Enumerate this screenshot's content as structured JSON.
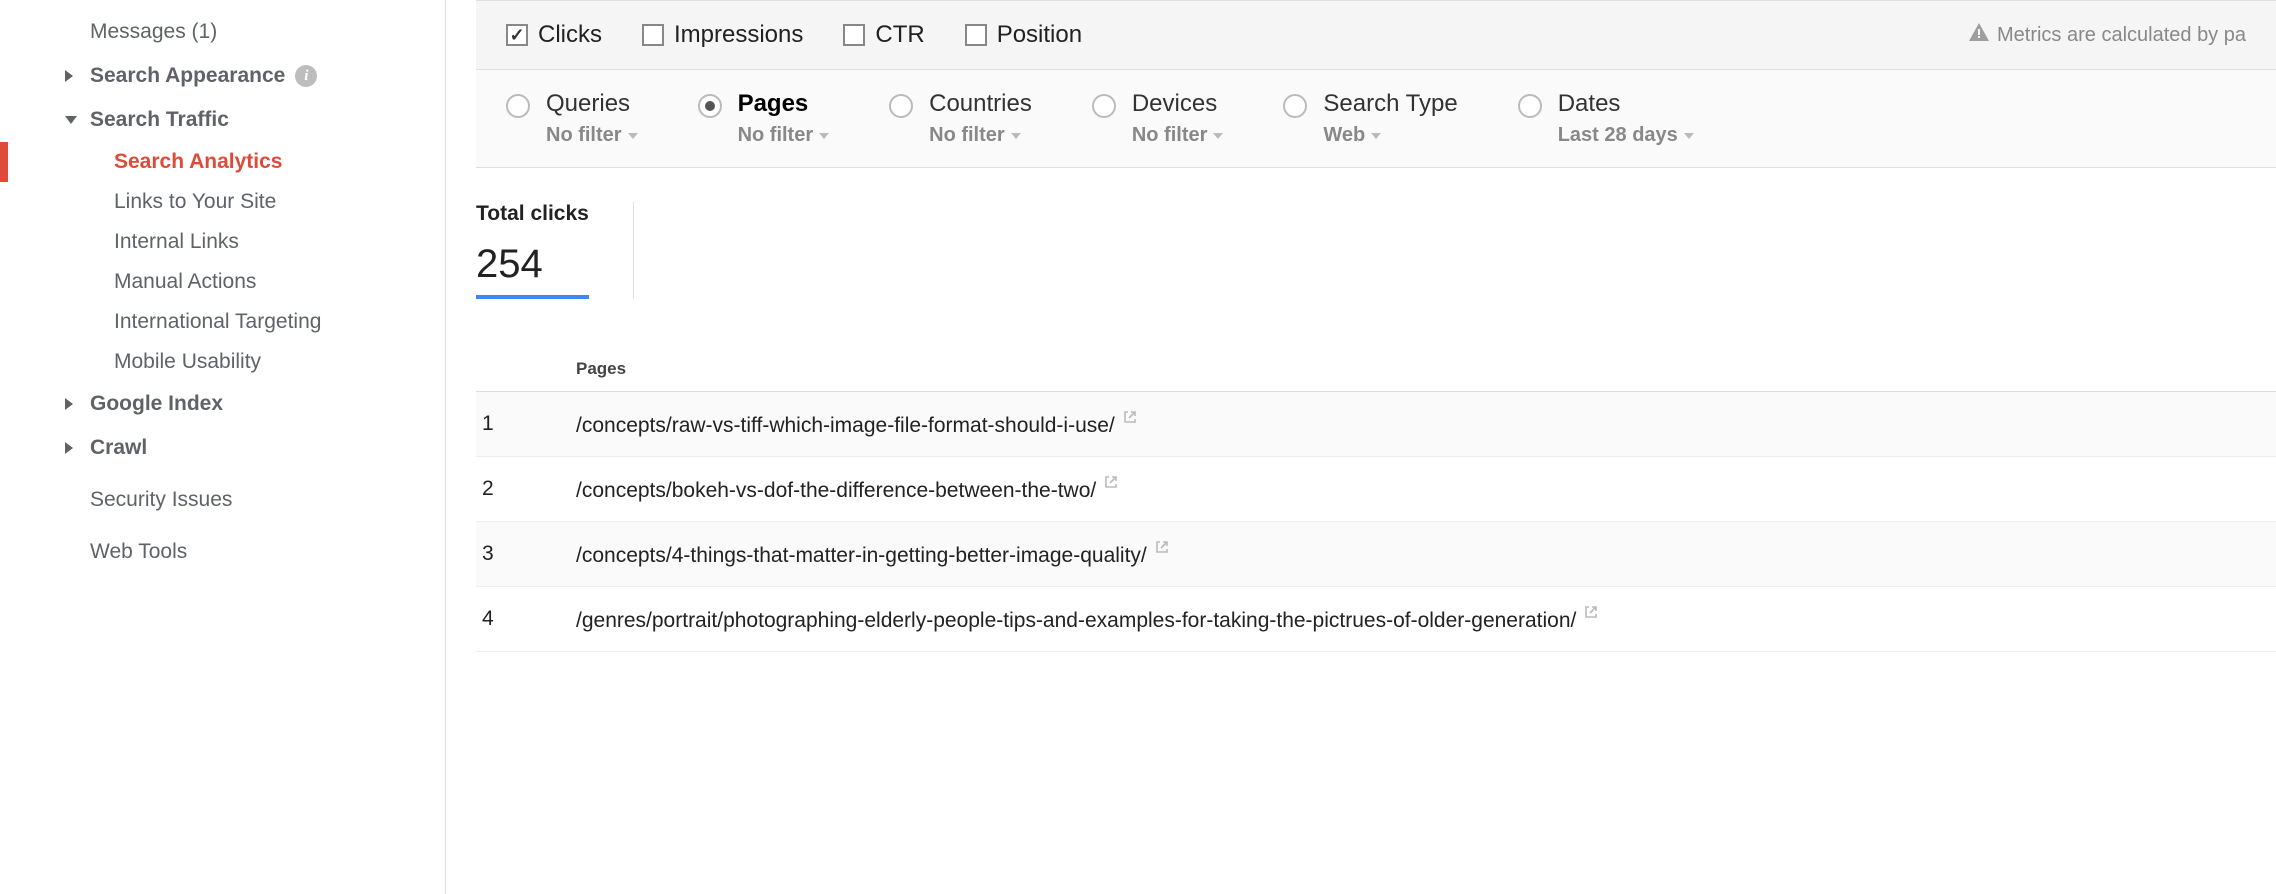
{
  "sidebar": {
    "messages": {
      "label": "Messages (1)"
    },
    "search_appearance": {
      "label": "Search Appearance"
    },
    "search_traffic": {
      "label": "Search Traffic",
      "items": [
        {
          "label": "Search Analytics"
        },
        {
          "label": "Links to Your Site"
        },
        {
          "label": "Internal Links"
        },
        {
          "label": "Manual Actions"
        },
        {
          "label": "International Targeting"
        },
        {
          "label": "Mobile Usability"
        }
      ]
    },
    "google_index": {
      "label": "Google Index"
    },
    "crawl": {
      "label": "Crawl"
    },
    "security_issues": {
      "label": "Security Issues"
    },
    "web_tools": {
      "label": "Web Tools"
    }
  },
  "metrics": {
    "clicks": "Clicks",
    "impressions": "Impressions",
    "ctr": "CTR",
    "position": "Position",
    "notice": "Metrics are calculated by pa"
  },
  "dimensions": {
    "queries": {
      "title": "Queries",
      "filter": "No filter"
    },
    "pages": {
      "title": "Pages",
      "filter": "No filter"
    },
    "countries": {
      "title": "Countries",
      "filter": "No filter"
    },
    "devices": {
      "title": "Devices",
      "filter": "No filter"
    },
    "search_type": {
      "title": "Search Type",
      "filter": "Web"
    },
    "dates": {
      "title": "Dates",
      "filter": "Last 28 days"
    }
  },
  "summary": {
    "total_clicks_label": "Total clicks",
    "total_clicks_value": "254"
  },
  "table": {
    "header": "Pages",
    "rows": [
      {
        "n": "1",
        "page": "/concepts/raw-vs-tiff-which-image-file-format-should-i-use/"
      },
      {
        "n": "2",
        "page": "/concepts/bokeh-vs-dof-the-difference-between-the-two/"
      },
      {
        "n": "3",
        "page": "/concepts/4-things-that-matter-in-getting-better-image-quality/"
      },
      {
        "n": "4",
        "page": "/genres/portrait/photographing-elderly-people-tips-and-examples-for-taking-the-pictrues-of-older-generation/"
      }
    ]
  }
}
